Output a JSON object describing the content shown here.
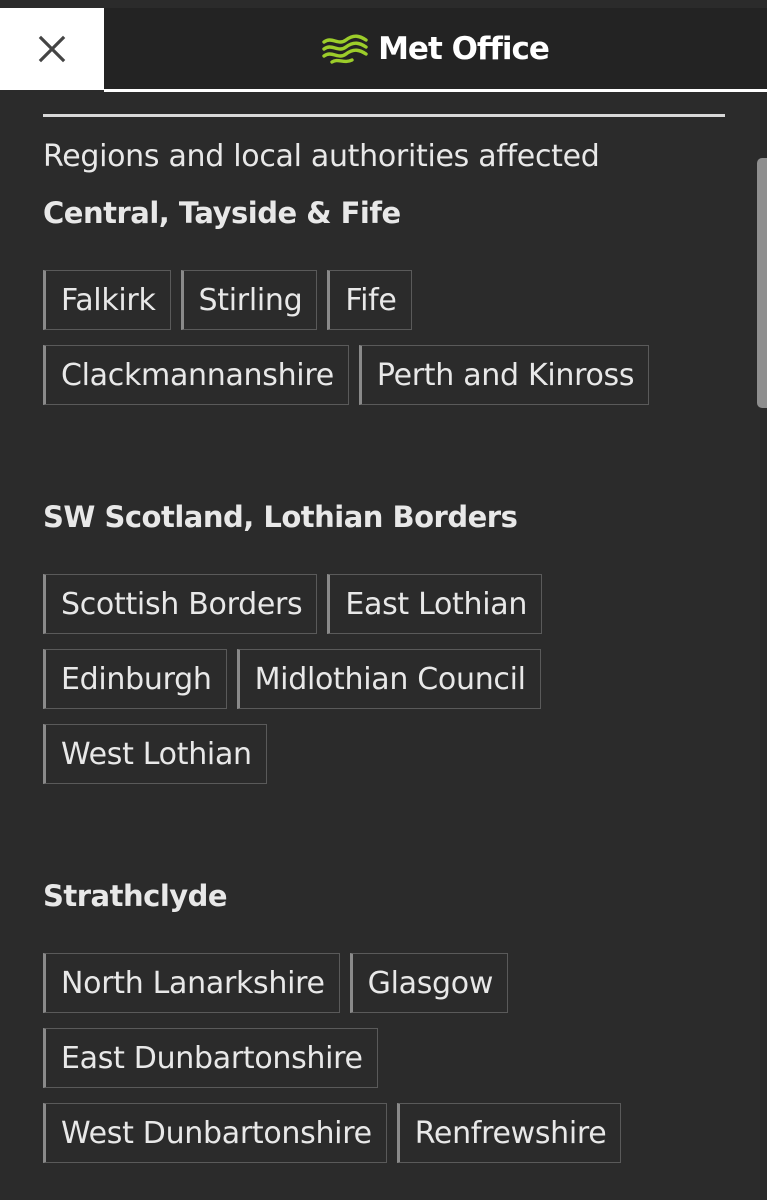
{
  "header": {
    "brand_name": "Met Office",
    "close_icon": "close-icon",
    "logo_icon": "met-office-wave-logo",
    "logo_color": "#9ccd2a"
  },
  "main": {
    "section_label": "Regions and local authorities affected",
    "regions": [
      {
        "title": "Central, Tayside & Fife",
        "areas": [
          "Falkirk",
          "Stirling",
          "Fife",
          "Clackmannanshire",
          "Perth and Kinross"
        ]
      },
      {
        "title": "SW Scotland, Lothian Borders",
        "areas": [
          "Scottish Borders",
          "East Lothian",
          "Edinburgh",
          "Midlothian Council",
          "West Lothian"
        ]
      },
      {
        "title": "Strathclyde",
        "areas": [
          "North Lanarkshire",
          "Glasgow",
          "East Dunbartonshire",
          "West Dunbartonshire",
          "Renfrewshire"
        ]
      }
    ]
  },
  "colors": {
    "background": "#2b2b2b",
    "header_background": "#232323",
    "close_button_background": "#ffffff",
    "text": "#e8e8e8"
  }
}
